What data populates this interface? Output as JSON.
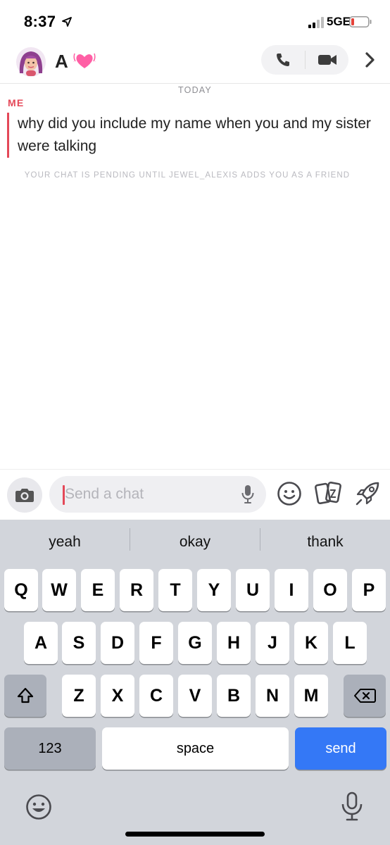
{
  "status_bar": {
    "time": "8:37",
    "network": "5GE"
  },
  "header": {
    "contact_name": "A"
  },
  "conversation": {
    "date_separator": "TODAY",
    "sender": "ME",
    "message": "why did you include my name when you and my sister were talking",
    "pending_notice": "YOUR CHAT IS PENDING UNTIL JEWEL_ALEXIS ADDS YOU AS A FRIEND"
  },
  "composer": {
    "placeholder": "Send a chat"
  },
  "keyboard": {
    "suggestions": [
      "yeah",
      "okay",
      "thank"
    ],
    "row1": [
      "Q",
      "W",
      "E",
      "R",
      "T",
      "Y",
      "U",
      "I",
      "O",
      "P"
    ],
    "row2": [
      "A",
      "S",
      "D",
      "F",
      "G",
      "H",
      "J",
      "K",
      "L"
    ],
    "row3": [
      "Z",
      "X",
      "C",
      "V",
      "B",
      "N",
      "M"
    ],
    "numbers_label": "123",
    "space_label": "space",
    "send_label": "send"
  },
  "colors": {
    "accent_red": "#e44858",
    "send_blue": "#3478f6",
    "keyboard_bg": "#d2d5db"
  },
  "icons": [
    "location-arrow-icon",
    "signal-icon",
    "battery-icon",
    "bitmoji-avatar",
    "heart-icon",
    "phone-icon",
    "video-icon",
    "chevron-right-icon",
    "camera-icon",
    "microphone-icon",
    "smiley-icon",
    "cards-icon",
    "rocket-icon",
    "shift-icon",
    "backspace-icon",
    "emoji-keyboard-icon",
    "dictation-icon"
  ]
}
